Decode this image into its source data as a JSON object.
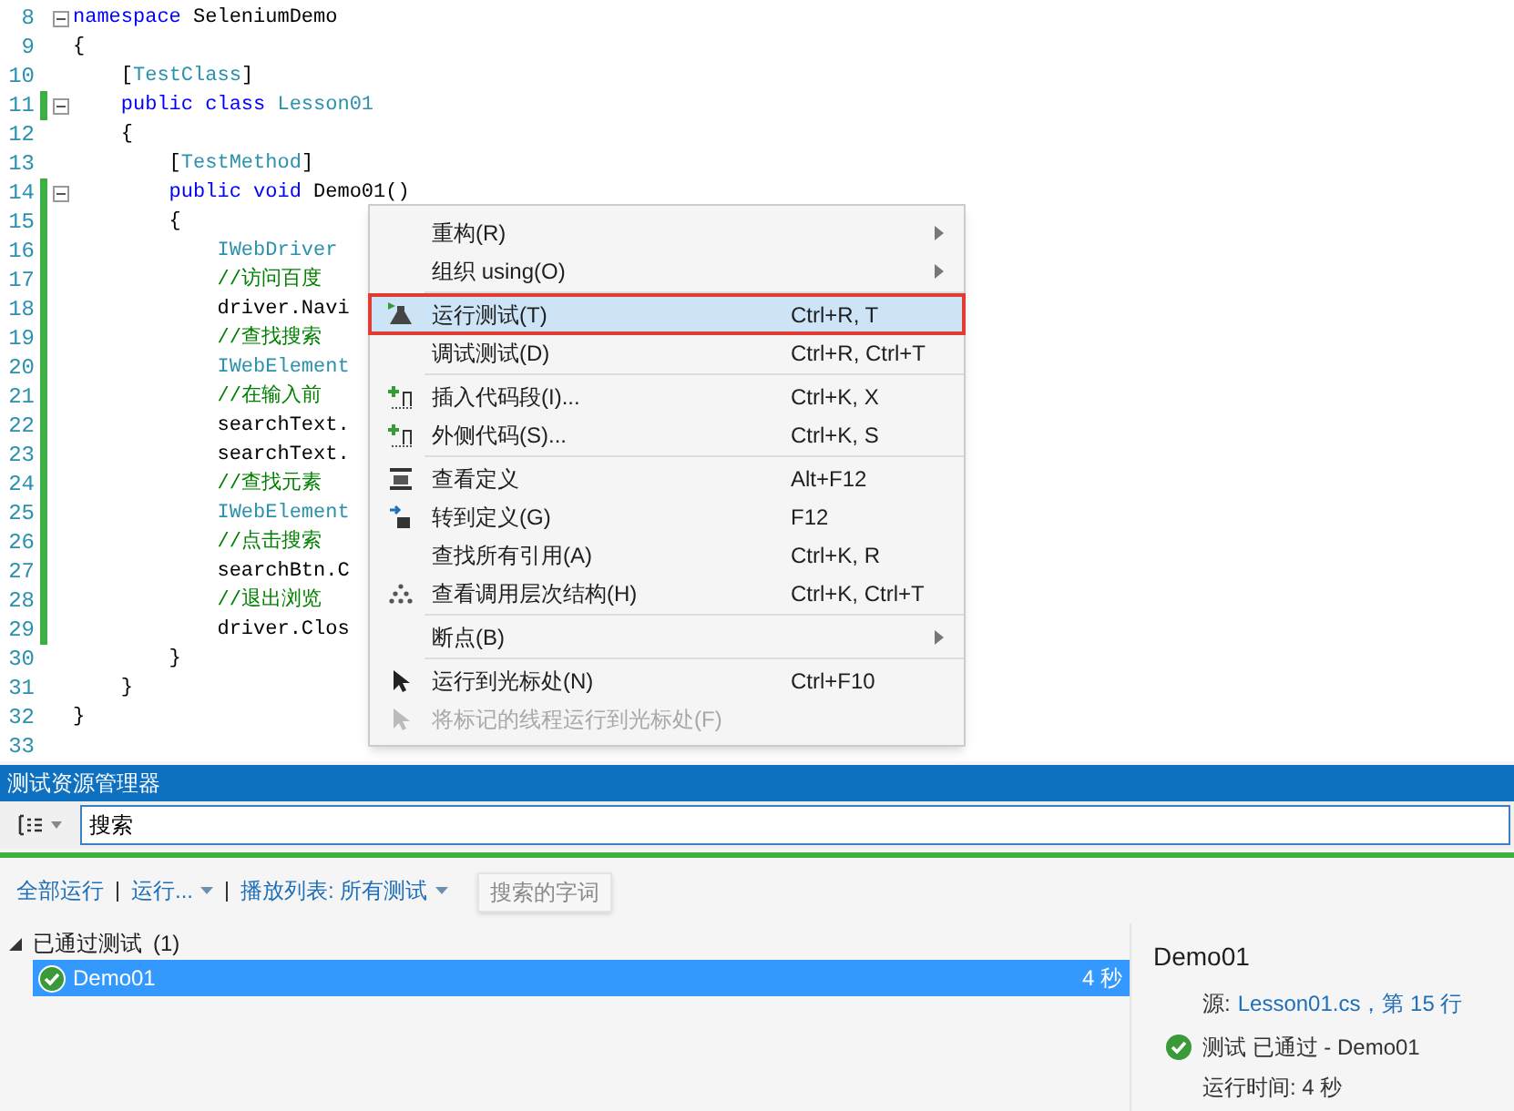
{
  "editor": {
    "lines": [
      {
        "number": "8",
        "modified": false,
        "fold": true,
        "segments": [
          {
            "text": "namespace",
            "kind": "keyword"
          },
          {
            "text": " SeleniumDemo",
            "kind": "plain"
          }
        ]
      },
      {
        "number": "9",
        "modified": false,
        "fold": false,
        "segments": [
          {
            "text": "{",
            "kind": "plain"
          }
        ]
      },
      {
        "number": "10",
        "modified": false,
        "fold": false,
        "segments": [
          {
            "text": "    [",
            "kind": "plain"
          },
          {
            "text": "TestClass",
            "kind": "type"
          },
          {
            "text": "]",
            "kind": "plain"
          }
        ]
      },
      {
        "number": "11",
        "modified": true,
        "fold": true,
        "segments": [
          {
            "text": "    public class",
            "kind": "keyword"
          },
          {
            "text": " Lesson01",
            "kind": "type"
          }
        ]
      },
      {
        "number": "12",
        "modified": false,
        "fold": false,
        "segments": [
          {
            "text": "    {",
            "kind": "plain"
          }
        ]
      },
      {
        "number": "13",
        "modified": false,
        "fold": false,
        "segments": [
          {
            "text": "        [",
            "kind": "plain"
          },
          {
            "text": "TestMethod",
            "kind": "type"
          },
          {
            "text": "]",
            "kind": "plain"
          }
        ]
      },
      {
        "number": "14",
        "modified": true,
        "fold": true,
        "segments": [
          {
            "text": "        public void",
            "kind": "keyword"
          },
          {
            "text": " Demo01()",
            "kind": "plain"
          }
        ]
      },
      {
        "number": "15",
        "modified": true,
        "fold": false,
        "segments": [
          {
            "text": "        {",
            "kind": "plain"
          }
        ]
      },
      {
        "number": "16",
        "modified": true,
        "fold": false,
        "segments": [
          {
            "text": "            IWebDriver",
            "kind": "type"
          }
        ]
      },
      {
        "number": "17",
        "modified": true,
        "fold": false,
        "segments": [
          {
            "text": "            //访问百度",
            "kind": "comment"
          }
        ]
      },
      {
        "number": "18",
        "modified": true,
        "fold": false,
        "segments": [
          {
            "text": "            driver.Navi",
            "kind": "plain"
          }
        ]
      },
      {
        "number": "19",
        "modified": true,
        "fold": false,
        "segments": [
          {
            "text": "            //查找搜索",
            "kind": "comment"
          }
        ]
      },
      {
        "number": "20",
        "modified": true,
        "fold": false,
        "segments": [
          {
            "text": "            IWebElement",
            "kind": "type"
          }
        ]
      },
      {
        "number": "21",
        "modified": true,
        "fold": false,
        "segments": [
          {
            "text": "            //在输入前",
            "kind": "comment"
          }
        ]
      },
      {
        "number": "22",
        "modified": true,
        "fold": false,
        "segments": [
          {
            "text": "            searchText.",
            "kind": "plain"
          }
        ]
      },
      {
        "number": "23",
        "modified": true,
        "fold": false,
        "segments": [
          {
            "text": "            searchText.",
            "kind": "plain"
          }
        ]
      },
      {
        "number": "24",
        "modified": true,
        "fold": false,
        "segments": [
          {
            "text": "            //查找元素",
            "kind": "comment"
          }
        ]
      },
      {
        "number": "25",
        "modified": true,
        "fold": false,
        "segments": [
          {
            "text": "            IWebElement",
            "kind": "type"
          }
        ]
      },
      {
        "number": "26",
        "modified": true,
        "fold": false,
        "segments": [
          {
            "text": "            //点击搜索",
            "kind": "comment"
          }
        ]
      },
      {
        "number": "27",
        "modified": true,
        "fold": false,
        "segments": [
          {
            "text": "            searchBtn.C",
            "kind": "plain"
          }
        ]
      },
      {
        "number": "28",
        "modified": true,
        "fold": false,
        "segments": [
          {
            "text": "            //退出浏览",
            "kind": "comment"
          }
        ]
      },
      {
        "number": "29",
        "modified": true,
        "fold": false,
        "segments": [
          {
            "text": "            driver.Clos",
            "kind": "plain"
          }
        ]
      },
      {
        "number": "30",
        "modified": false,
        "fold": false,
        "segments": [
          {
            "text": "        }",
            "kind": "plain"
          }
        ]
      },
      {
        "number": "31",
        "modified": false,
        "fold": false,
        "segments": [
          {
            "text": "    }",
            "kind": "plain"
          }
        ]
      },
      {
        "number": "32",
        "modified": false,
        "fold": false,
        "segments": [
          {
            "text": "}",
            "kind": "plain"
          }
        ]
      },
      {
        "number": "33",
        "modified": false,
        "fold": false
      }
    ]
  },
  "context_menu": {
    "items": [
      {
        "kind": "item",
        "label": "重构(R)",
        "submenu": true,
        "selected": false,
        "disabled": false
      },
      {
        "kind": "item",
        "label": "组织 using(O)",
        "submenu": true,
        "selected": false,
        "disabled": false
      },
      {
        "kind": "separator"
      },
      {
        "kind": "item",
        "label": "运行测试(T)",
        "shortcut": "Ctrl+R, T",
        "submenu": false,
        "selected": true,
        "disabled": false
      },
      {
        "kind": "item",
        "label": "调试测试(D)",
        "shortcut": "Ctrl+R, Ctrl+T",
        "submenu": false,
        "selected": false,
        "disabled": false
      },
      {
        "kind": "separator"
      },
      {
        "kind": "item",
        "label": "插入代码段(I)...",
        "shortcut": "Ctrl+K, X",
        "submenu": false,
        "selected": false,
        "disabled": false
      },
      {
        "kind": "item",
        "label": "外侧代码(S)...",
        "shortcut": "Ctrl+K, S",
        "submenu": false,
        "selected": false,
        "disabled": false
      },
      {
        "kind": "separator"
      },
      {
        "kind": "item",
        "label": "查看定义",
        "shortcut": "Alt+F12",
        "submenu": false,
        "selected": false,
        "disabled": false
      },
      {
        "kind": "item",
        "label": "转到定义(G)",
        "shortcut": "F12",
        "submenu": false,
        "selected": false,
        "disabled": false
      },
      {
        "kind": "item",
        "label": "查找所有引用(A)",
        "shortcut": "Ctrl+K, R",
        "submenu": false,
        "selected": false,
        "disabled": false
      },
      {
        "kind": "item",
        "label": "查看调用层次结构(H)",
        "shortcut": "Ctrl+K, Ctrl+T",
        "submenu": false,
        "selected": false,
        "disabled": false
      },
      {
        "kind": "separator"
      },
      {
        "kind": "item",
        "label": "断点(B)",
        "submenu": true,
        "selected": false,
        "disabled": false
      },
      {
        "kind": "separator"
      },
      {
        "kind": "item",
        "label": "运行到光标处(N)",
        "shortcut": "Ctrl+F10",
        "submenu": false,
        "selected": false,
        "disabled": false
      },
      {
        "kind": "item",
        "label": "将标记的线程运行到光标处(F)",
        "submenu": false,
        "selected": false,
        "disabled": true
      }
    ]
  },
  "test_explorer": {
    "title": "测试资源管理器",
    "search": {
      "value": "搜索"
    },
    "toolbar": [
      {
        "label": "全部运行",
        "dropdown": false
      },
      {
        "label": "运行...",
        "dropdown": true
      },
      {
        "label": "播放列表: 所有测试",
        "dropdown": true
      }
    ],
    "tooltip": "搜索的字词",
    "groups": [
      {
        "label": "已通过测试",
        "count": "(1)",
        "expanded": true,
        "tests": [
          {
            "name": "Demo01",
            "duration": "4 秒",
            "selected": true
          }
        ]
      }
    ],
    "details": {
      "title": "Demo01",
      "source_label": "源:",
      "source_link": "Lesson01.cs，第 15 行",
      "status": "测试 已通过 - Demo01",
      "run_time": "运行时间: 4 秒"
    }
  }
}
